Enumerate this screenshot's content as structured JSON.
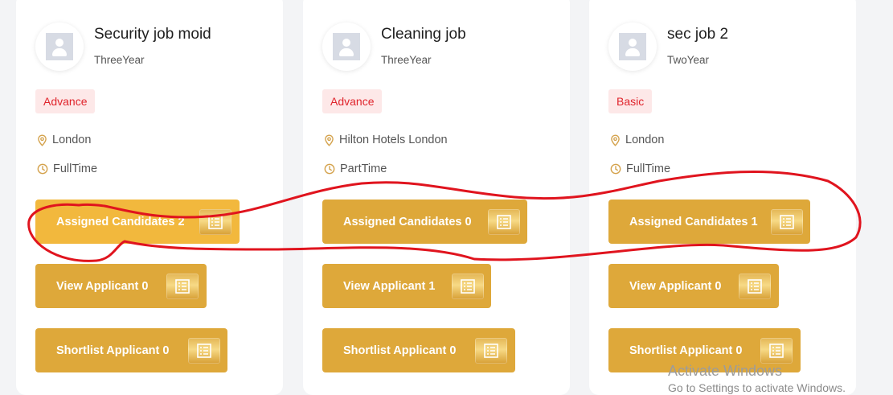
{
  "jobs": [
    {
      "title": "Security job moid",
      "subtitle": "ThreeYear",
      "badge": "Advance",
      "location": "London",
      "job_type": "FullTime",
      "buttons": {
        "assigned": "Assigned Candidates 2",
        "view": "View Applicant 0",
        "shortlist": "Shortlist Applicant 0"
      }
    },
    {
      "title": "Cleaning job",
      "subtitle": "ThreeYear",
      "badge": "Advance",
      "location": "Hilton Hotels London",
      "job_type": "PartTime",
      "buttons": {
        "assigned": "Assigned Candidates 0",
        "view": "View Applicant 1",
        "shortlist": "Shortlist Applicant 0"
      }
    },
    {
      "title": "sec job 2",
      "subtitle": "TwoYear",
      "badge": "Basic",
      "location": "London",
      "job_type": "FullTime",
      "buttons": {
        "assigned": "Assigned Candidates 1",
        "view": "View Applicant 0",
        "shortlist": "Shortlist Applicant 0"
      }
    }
  ],
  "watermark": {
    "line1": "Activate Windows",
    "line2": "Go to Settings to activate Windows."
  },
  "colors": {
    "button": "#dea83a",
    "button_active": "#f2b83d",
    "badge_bg": "#fde8e8",
    "badge_text": "#e0242c",
    "icon_accent": "#d4a24c",
    "annotation": "#e0141e"
  },
  "icons": {
    "location": "map-pin-icon",
    "job_type": "clock-icon",
    "button": "list-icon",
    "avatar": "user-placeholder-icon"
  }
}
